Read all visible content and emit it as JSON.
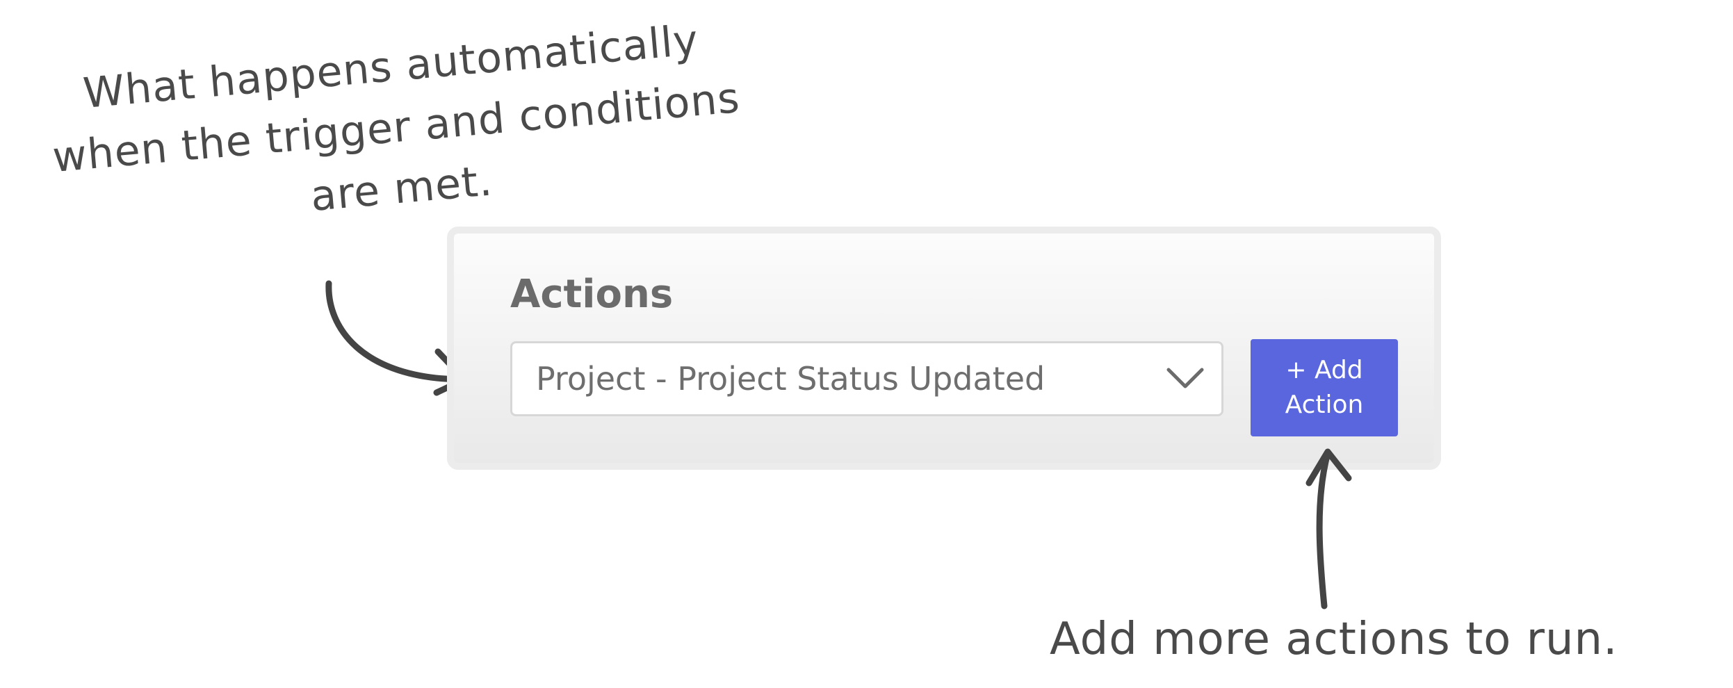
{
  "annotations": {
    "top_note": {
      "lines": [
        "What happens automatically",
        "when the trigger and conditions",
        "are met."
      ]
    },
    "bottom_note": {
      "text": "Add more actions to run."
    }
  },
  "panel": {
    "title": "Actions",
    "select": {
      "value": "Project - Project Status Updated",
      "icon": "chevron-down-icon"
    },
    "add_button": {
      "line1": "+ Add",
      "line2": "Action"
    }
  },
  "colors": {
    "accent_button": "#5a66de",
    "annotation_ink": "#4a4a4a",
    "panel_border": "#ececec",
    "title_text": "#6b6b6b"
  }
}
